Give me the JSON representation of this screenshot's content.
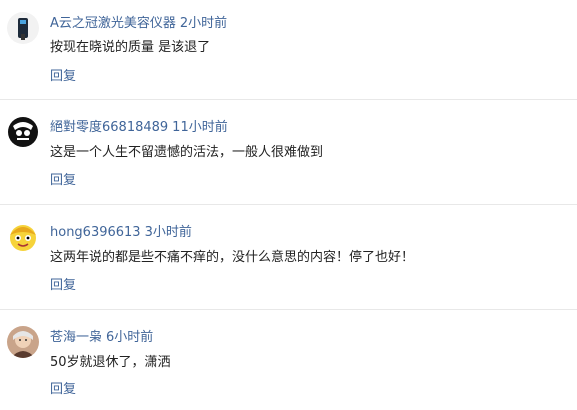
{
  "comments": [
    {
      "username": "A云之冠激光美容仪器",
      "time": "2小时前",
      "text": "按现在晓说的质量 是该退了",
      "reply_label": "回复"
    },
    {
      "username": "絕對零度66818489",
      "time": "11小时前",
      "text": "这是一个人生不留遗憾的活法，一般人很难做到",
      "reply_label": "回复"
    },
    {
      "username": "hong6396613",
      "time": "3小时前",
      "text": "这两年说的都是些不痛不痒的，没什么意思的内容！停了也好！",
      "reply_label": "回复"
    },
    {
      "username": "苍海一枭",
      "time": "6小时前",
      "text": "50岁就退休了，潇洒",
      "reply_label": "回复"
    }
  ],
  "colors": {
    "link": "#406599",
    "text": "#222222",
    "divider": "#e8e8e8"
  },
  "icons": [
    "avatar-device-icon",
    "avatar-bw-face-icon",
    "avatar-cartoon-icon",
    "avatar-photo-icon"
  ]
}
